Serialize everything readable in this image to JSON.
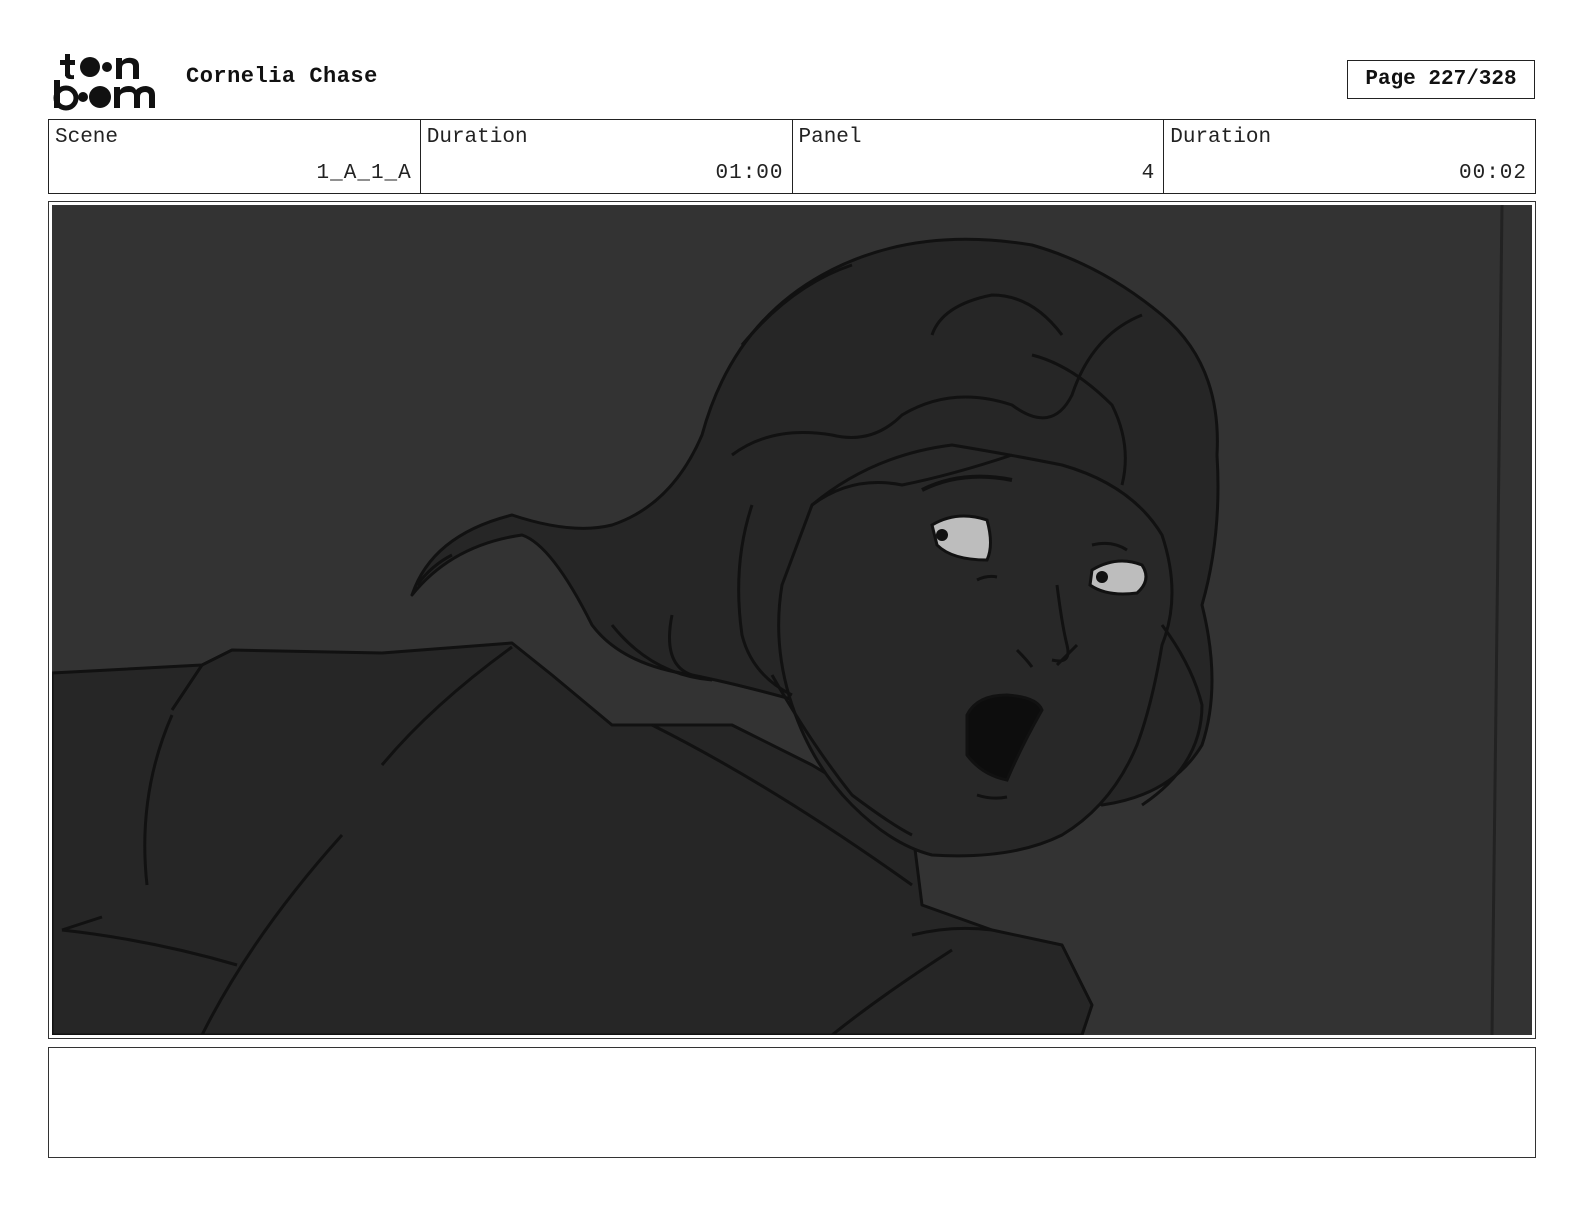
{
  "header": {
    "logo_name": "toon boom",
    "project_title": "Cornelia Chase",
    "page_label": "Page 227/328"
  },
  "info": {
    "scene_label": "Scene",
    "scene_value": "1_A_1_A",
    "scene_duration_label": "Duration",
    "scene_duration_value": "01:00",
    "panel_label": "Panel",
    "panel_value": "4",
    "panel_duration_label": "Duration",
    "panel_duration_value": "00:02"
  },
  "panel": {
    "image_subject": "storyboard sketch",
    "background_color": "#333333",
    "character_fill": "#262626",
    "eye_fill": "#bdbdbd"
  },
  "notes": {
    "text": ""
  }
}
